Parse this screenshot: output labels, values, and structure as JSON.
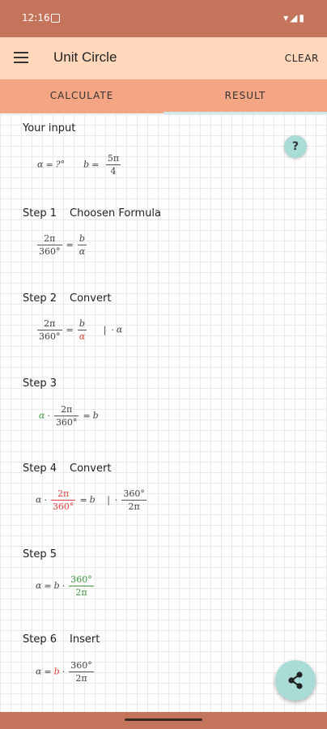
{
  "status": {
    "time": "12:16",
    "icons": "▾◢▮"
  },
  "appbar": {
    "title": "Unit Circle",
    "clear_label": "CLEAR"
  },
  "tabs": {
    "calculate": "CALCULATE",
    "result": "RESULT"
  },
  "input": {
    "label": "Your input",
    "alpha_sym": "α",
    "alpha_val": "?°",
    "b_sym": "b",
    "b_num": "5π",
    "b_den": "4"
  },
  "steps": [
    {
      "label": "Step 1",
      "desc": "Choosen Formula"
    },
    {
      "label": "Step 2",
      "desc": "Convert"
    },
    {
      "label": "Step 3",
      "desc": ""
    },
    {
      "label": "Step 4",
      "desc": "Convert"
    },
    {
      "label": "Step 5",
      "desc": ""
    },
    {
      "label": "Step 6",
      "desc": "Insert"
    }
  ],
  "math": {
    "two_pi": "2π",
    "deg360": "360°",
    "b": "b",
    "alpha": "α",
    "eq": "=",
    "dot": "·",
    "bar": "|"
  },
  "help": "?",
  "colors": {
    "status_bar": "#c4745a",
    "app_bar": "#ffd8bc",
    "tab_bar": "#f4a584",
    "fab": "#a9dcd6",
    "red": "#e2443f",
    "green": "#3f9a3f"
  }
}
